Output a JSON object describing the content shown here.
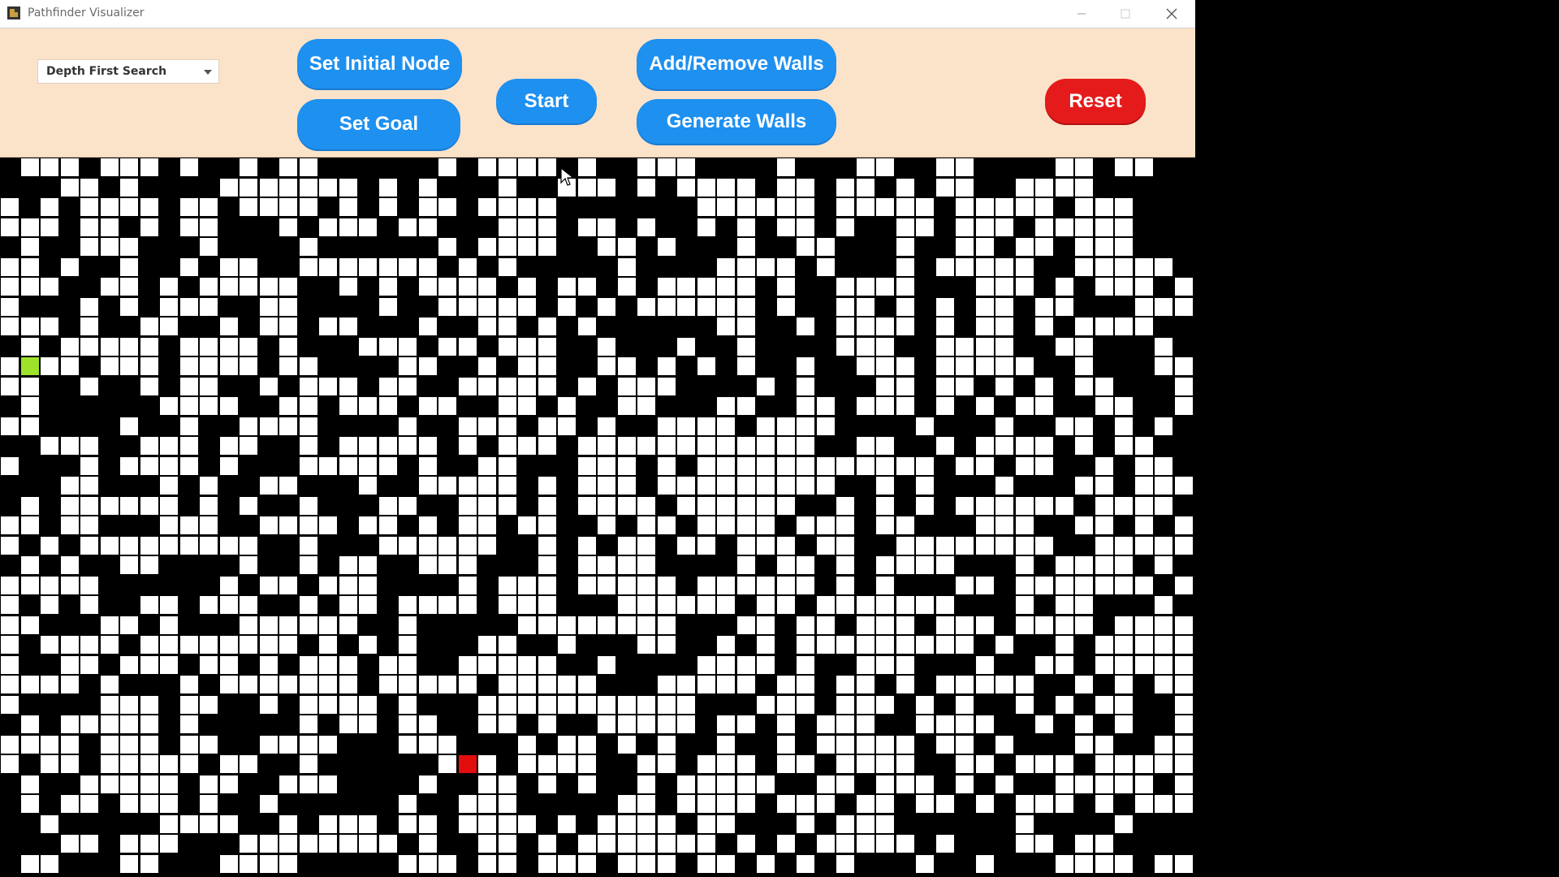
{
  "window": {
    "title": "Pathfinder Visualizer",
    "controls": [
      "minimize-icon",
      "maximize-icon",
      "close-icon"
    ]
  },
  "toolbar": {
    "algorithm_select": {
      "selected": "Depth First Search"
    },
    "buttons": {
      "set_initial": "Set Initial Node",
      "set_goal": "Set Goal",
      "start": "Start",
      "add_remove_walls": "Add/Remove Walls",
      "generate_walls": "Generate Walls",
      "reset": "Reset"
    }
  },
  "colors": {
    "toolbar_bg": "#fbe3c9",
    "primary_button": "#1e90f0",
    "reset_button": "#e51b1b",
    "wall": "#000000",
    "open_cell": "#ffffff",
    "start_node": "#9ee22a",
    "goal_node": "#e30d0d"
  },
  "grid": {
    "cols": 60,
    "rows": 36,
    "start": {
      "col": 1,
      "row": 10
    },
    "goal": {
      "col": 23,
      "row": 30
    }
  }
}
